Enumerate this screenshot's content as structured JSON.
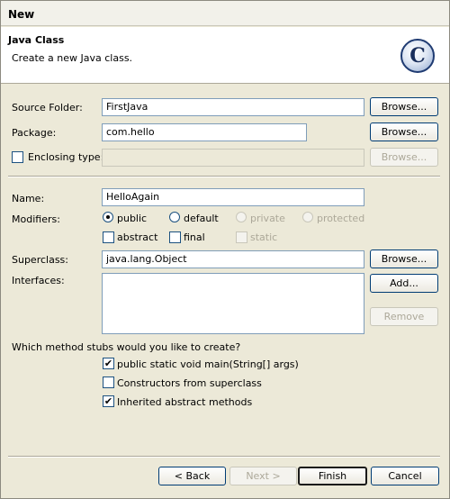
{
  "window": {
    "title": "New"
  },
  "banner": {
    "heading": "Java Class",
    "description": "Create a new Java class.",
    "badge_letter": "C"
  },
  "form": {
    "source_folder": {
      "label": "Source Folder:",
      "value": "FirstJava",
      "browse": "Browse..."
    },
    "package": {
      "label": "Package:",
      "value": "com.hello",
      "browse": "Browse..."
    },
    "enclosing_type": {
      "label": "Enclosing type:",
      "value": "",
      "browse": "Browse...",
      "checked": false
    },
    "name": {
      "label": "Name:",
      "value": "HelloAgain"
    },
    "modifiers": {
      "label": "Modifiers:",
      "public": "public",
      "default": "default",
      "private": "private",
      "protected": "protected",
      "abstract": "abstract",
      "final": "final",
      "static": "static",
      "selected": "public"
    },
    "superclass": {
      "label": "Superclass:",
      "value": "java.lang.Object",
      "browse": "Browse..."
    },
    "interfaces": {
      "label": "Interfaces:",
      "add": "Add...",
      "remove": "Remove"
    },
    "stubs": {
      "question": "Which method stubs would you like to create?",
      "main": {
        "label": "public static void main(String[] args)",
        "checked": true
      },
      "constructors": {
        "label": "Constructors from superclass",
        "checked": false
      },
      "inherited": {
        "label": "Inherited abstract methods",
        "checked": true
      }
    }
  },
  "footer": {
    "back": "< Back",
    "next": "Next >",
    "finish": "Finish",
    "cancel": "Cancel"
  }
}
